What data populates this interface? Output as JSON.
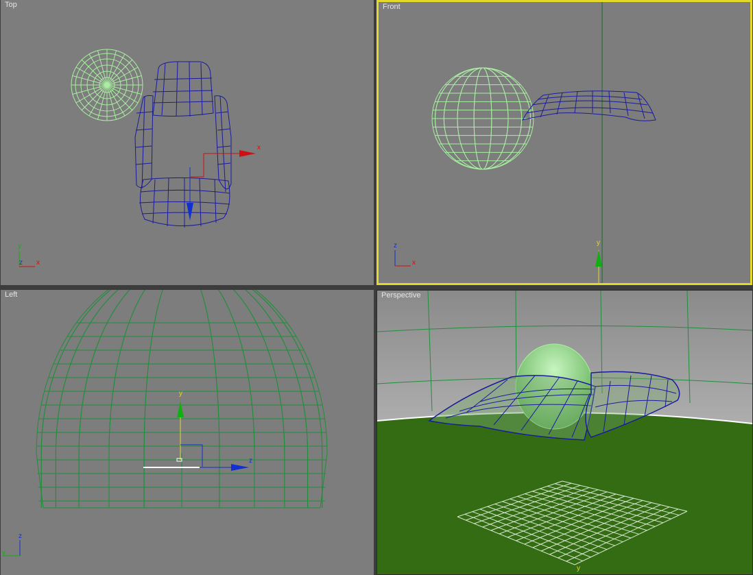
{
  "viewports": {
    "top": {
      "label": "Top",
      "active": false
    },
    "front": {
      "label": "Front",
      "active": true
    },
    "left": {
      "label": "Left",
      "active": false
    },
    "persp": {
      "label": "Perspective",
      "active": false
    }
  },
  "axis_labels": {
    "x": "x",
    "y": "y",
    "z": "z"
  },
  "colors": {
    "viewport_bg": "#7d7d7d",
    "active_border": "#e4d82a",
    "sphere_wire": "#a8f0a0",
    "cushion_wire": "#1a1a9c",
    "dome_wire": "#1f8f3a",
    "ground": "#346c14",
    "axis_x": "#d01010",
    "axis_y": "#10b010",
    "axis_z": "#1030d0"
  }
}
